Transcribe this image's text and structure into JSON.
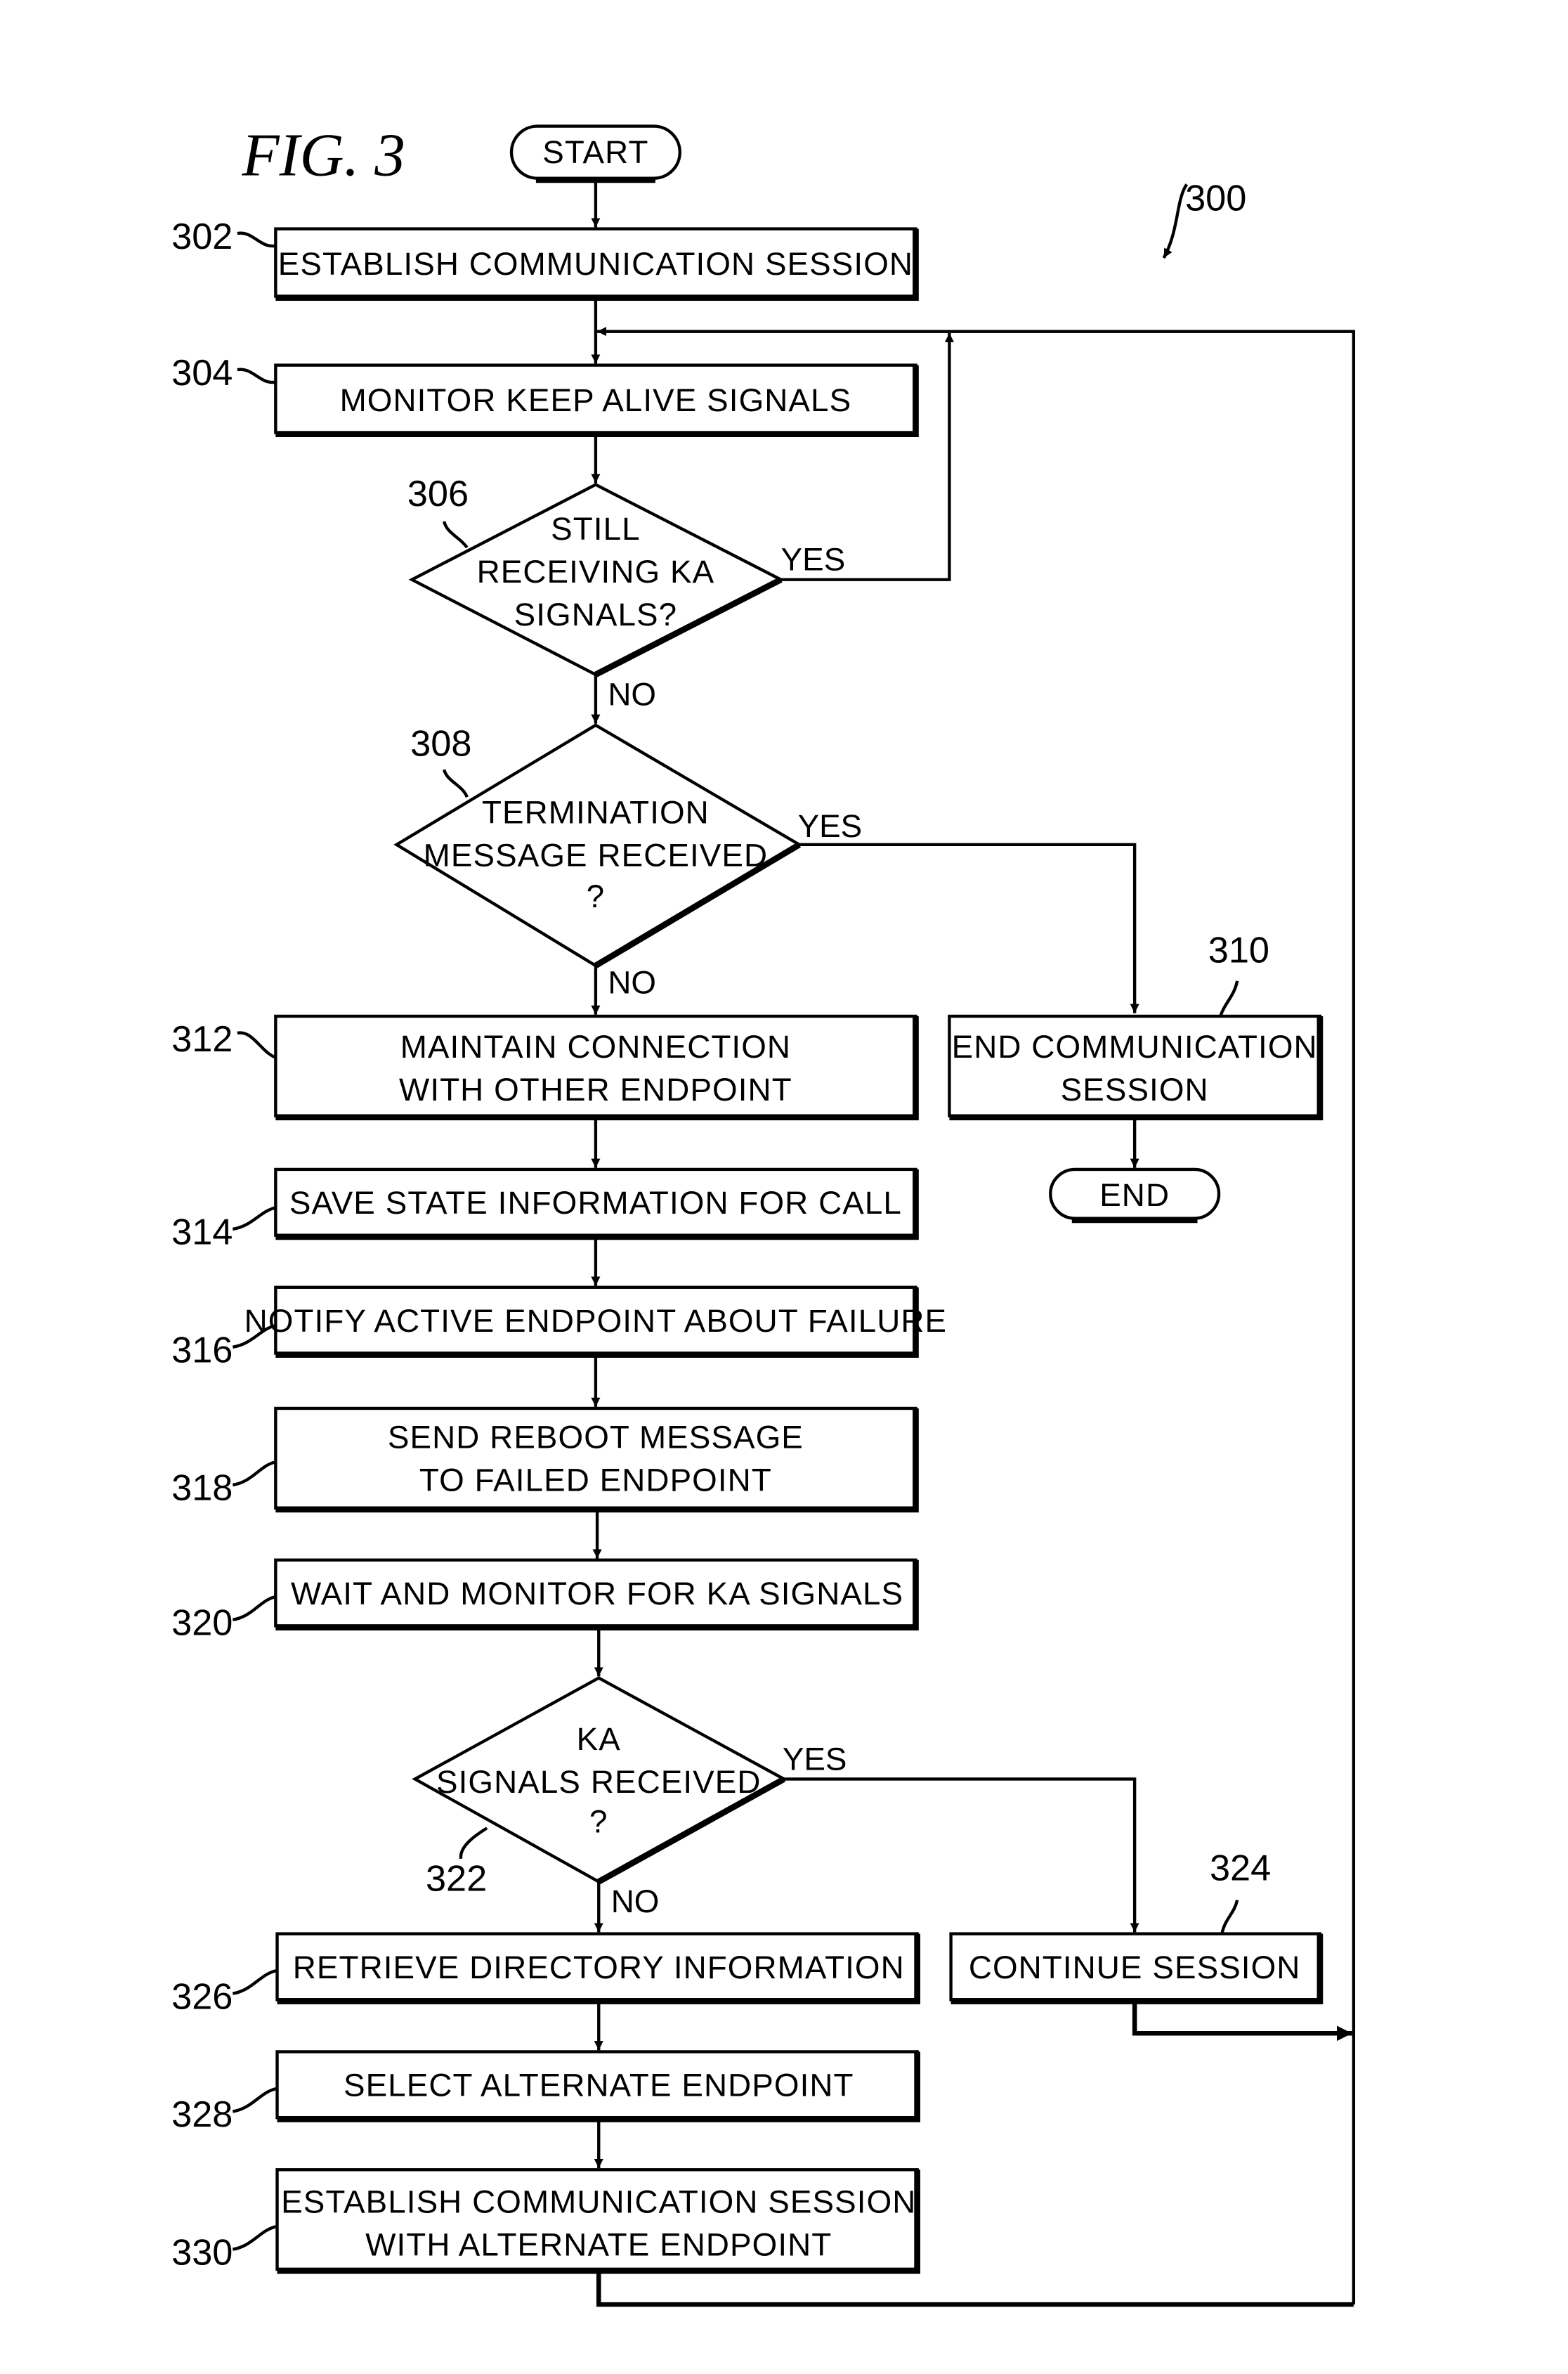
{
  "figure": {
    "title": "FIG. 3",
    "reference": "300"
  },
  "terminals": {
    "start": "START",
    "end": "END"
  },
  "steps": {
    "s302": {
      "ref": "302",
      "lines": [
        "ESTABLISH COMMUNICATION SESSION"
      ]
    },
    "s304": {
      "ref": "304",
      "lines": [
        "MONITOR KEEP ALIVE SIGNALS"
      ]
    },
    "s306": {
      "ref": "306",
      "lines": [
        "STILL",
        "RECEIVING KA",
        "SIGNALS?"
      ]
    },
    "s308": {
      "ref": "308",
      "lines": [
        "TERMINATION",
        "MESSAGE RECEIVED",
        "?"
      ]
    },
    "s310": {
      "ref": "310",
      "lines": [
        "END COMMUNICATION",
        "SESSION"
      ]
    },
    "s312": {
      "ref": "312",
      "lines": [
        "MAINTAIN CONNECTION",
        "WITH OTHER ENDPOINT"
      ]
    },
    "s314": {
      "ref": "314",
      "lines": [
        "SAVE STATE INFORMATION FOR CALL"
      ]
    },
    "s316": {
      "ref": "316",
      "lines": [
        "NOTIFY ACTIVE ENDPOINT ABOUT FAILURE"
      ]
    },
    "s318": {
      "ref": "318",
      "lines": [
        "SEND REBOOT MESSAGE",
        "TO FAILED ENDPOINT"
      ]
    },
    "s320": {
      "ref": "320",
      "lines": [
        "WAIT AND MONITOR FOR KA SIGNALS"
      ]
    },
    "s322": {
      "ref": "322",
      "lines": [
        "KA",
        "SIGNALS RECEIVED",
        "?"
      ]
    },
    "s324": {
      "ref": "324",
      "lines": [
        "CONTINUE SESSION"
      ]
    },
    "s326": {
      "ref": "326",
      "lines": [
        "RETRIEVE DIRECTORY INFORMATION"
      ]
    },
    "s328": {
      "ref": "328",
      "lines": [
        "SELECT ALTERNATE ENDPOINT"
      ]
    },
    "s330": {
      "ref": "330",
      "lines": [
        "ESTABLISH COMMUNICATION SESSION",
        "WITH ALTERNATE ENDPOINT"
      ]
    }
  },
  "branch_labels": {
    "yes": "YES",
    "no": "NO"
  }
}
